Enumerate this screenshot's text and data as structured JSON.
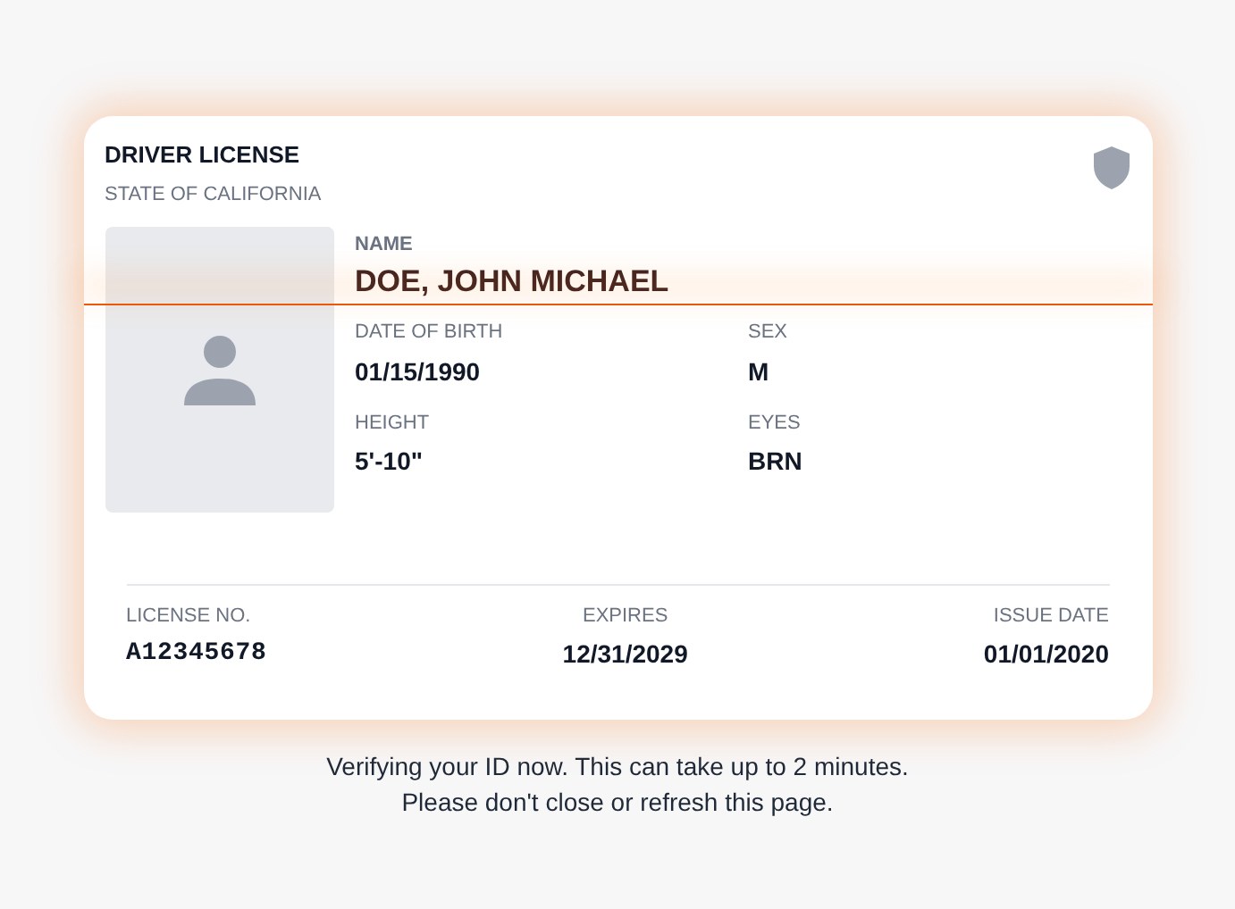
{
  "card": {
    "title": "DRIVER LICENSE",
    "subtitle": "STATE OF CALIFORNIA",
    "name": {
      "label": "NAME",
      "value": "DOE, JOHN MICHAEL"
    },
    "fields": [
      {
        "label": "DATE OF BIRTH",
        "value": "01/15/1990"
      },
      {
        "label": "SEX",
        "value": "M"
      },
      {
        "label": "HEIGHT",
        "value": "5'-10\""
      },
      {
        "label": "EYES",
        "value": "BRN"
      }
    ],
    "footer": [
      {
        "label": "LICENSE NO.",
        "value": "A12345678",
        "kind": "mono"
      },
      {
        "label": "EXPIRES",
        "value": "12/31/2029",
        "kind": "plain"
      },
      {
        "label": "ISSUE DATE",
        "value": "01/01/2020",
        "kind": "plain"
      }
    ]
  },
  "message": [
    "Verifying your ID now. This can take up to 2 minutes.",
    "Please don't close or refresh this page."
  ]
}
